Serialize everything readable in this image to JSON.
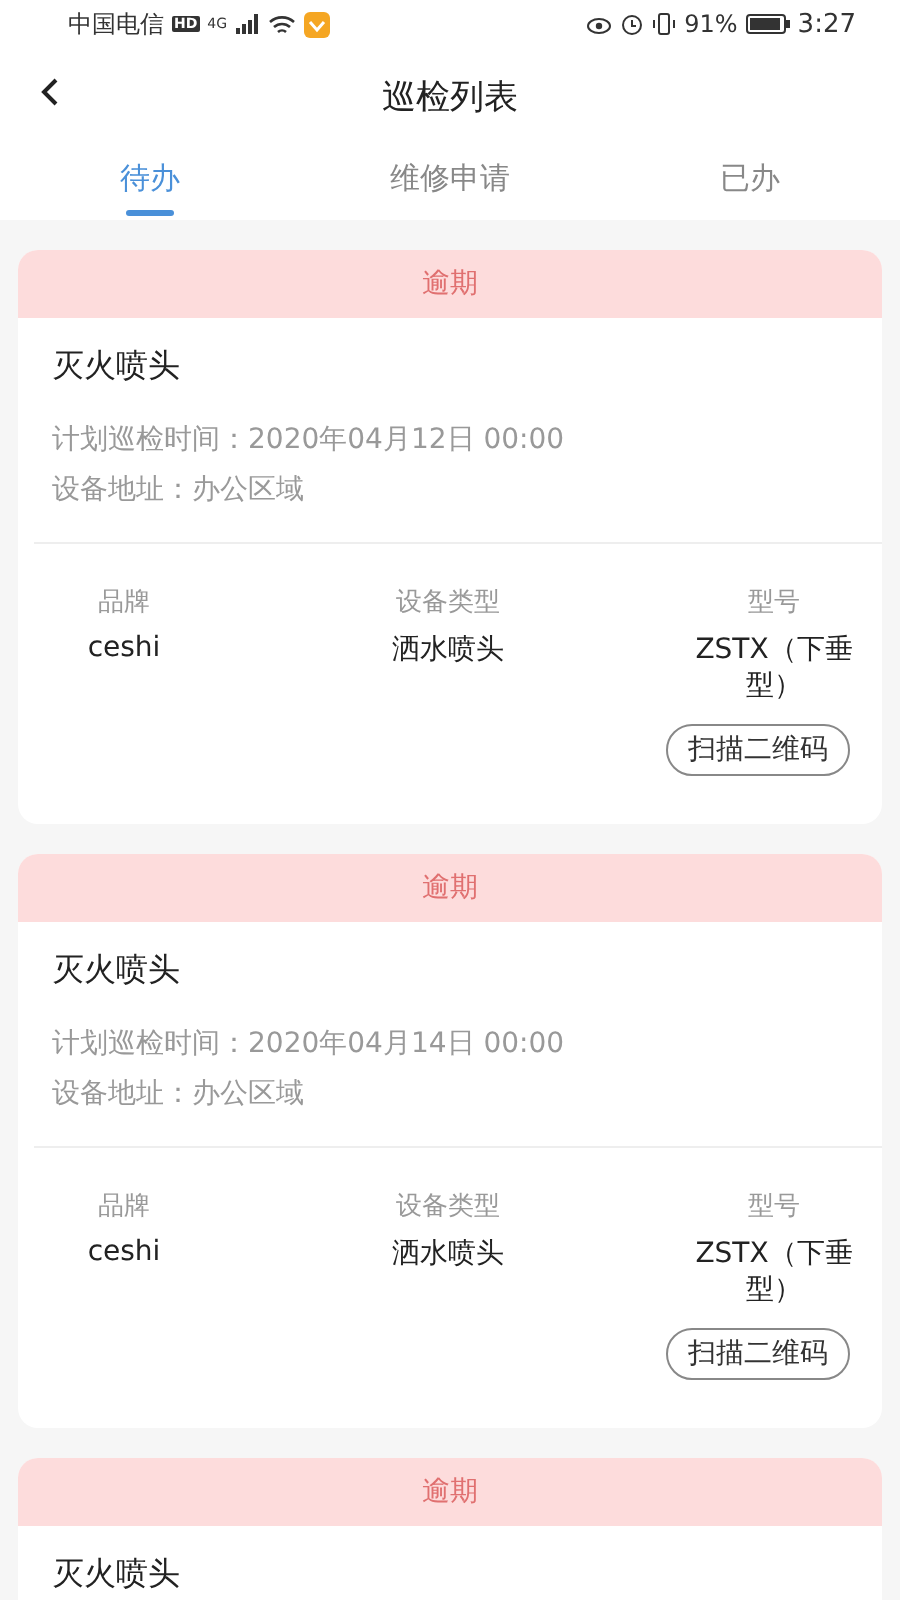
{
  "status_bar": {
    "carrier": "中国电信",
    "hd": "HD",
    "network": "4G",
    "battery": "91%",
    "time": "3:27"
  },
  "header": {
    "title": "巡检列表"
  },
  "tabs": [
    {
      "label": "待办",
      "selected": true
    },
    {
      "label": "维修申请",
      "selected": false
    },
    {
      "label": "已办",
      "selected": false
    }
  ],
  "cards": [
    {
      "status": "逾期",
      "name": "灭火喷头",
      "planned_time": "计划巡检时间：2020年04月12日 00:00",
      "address": "设备地址：办公区域",
      "columns": [
        {
          "label": "品牌",
          "value": "ceshi"
        },
        {
          "label": "设备类型",
          "value": "洒水喷头"
        },
        {
          "label": "型号",
          "value": "ZSTX（下垂型）"
        }
      ],
      "button": "扫描二维码"
    },
    {
      "status": "逾期",
      "name": "灭火喷头",
      "planned_time": "计划巡检时间：2020年04月14日 00:00",
      "address": "设备地址：办公区域",
      "columns": [
        {
          "label": "品牌",
          "value": "ceshi"
        },
        {
          "label": "设备类型",
          "value": "洒水喷头"
        },
        {
          "label": "型号",
          "value": "ZSTX（下垂型）"
        }
      ],
      "button": "扫描二维码"
    },
    {
      "status": "逾期",
      "name": "灭火喷头"
    }
  ]
}
